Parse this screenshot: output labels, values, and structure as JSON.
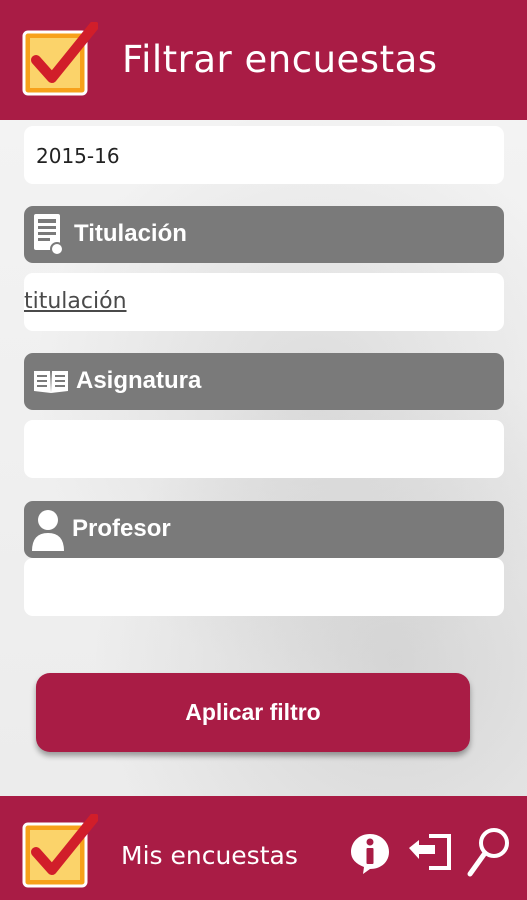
{
  "header": {
    "title": "Filtrar encuestas"
  },
  "filters": {
    "year_value": "2015-16",
    "titulacion": {
      "label": "Titulación",
      "value": "titulación"
    },
    "asignatura": {
      "label": "Asignatura",
      "value": ""
    },
    "profesor": {
      "label": "Profesor",
      "value": ""
    }
  },
  "actions": {
    "apply_label": "Aplicar filtro"
  },
  "footer": {
    "title": "Mis encuestas"
  },
  "colors": {
    "brand": "#a91c45",
    "section": "#7a7a7a"
  }
}
